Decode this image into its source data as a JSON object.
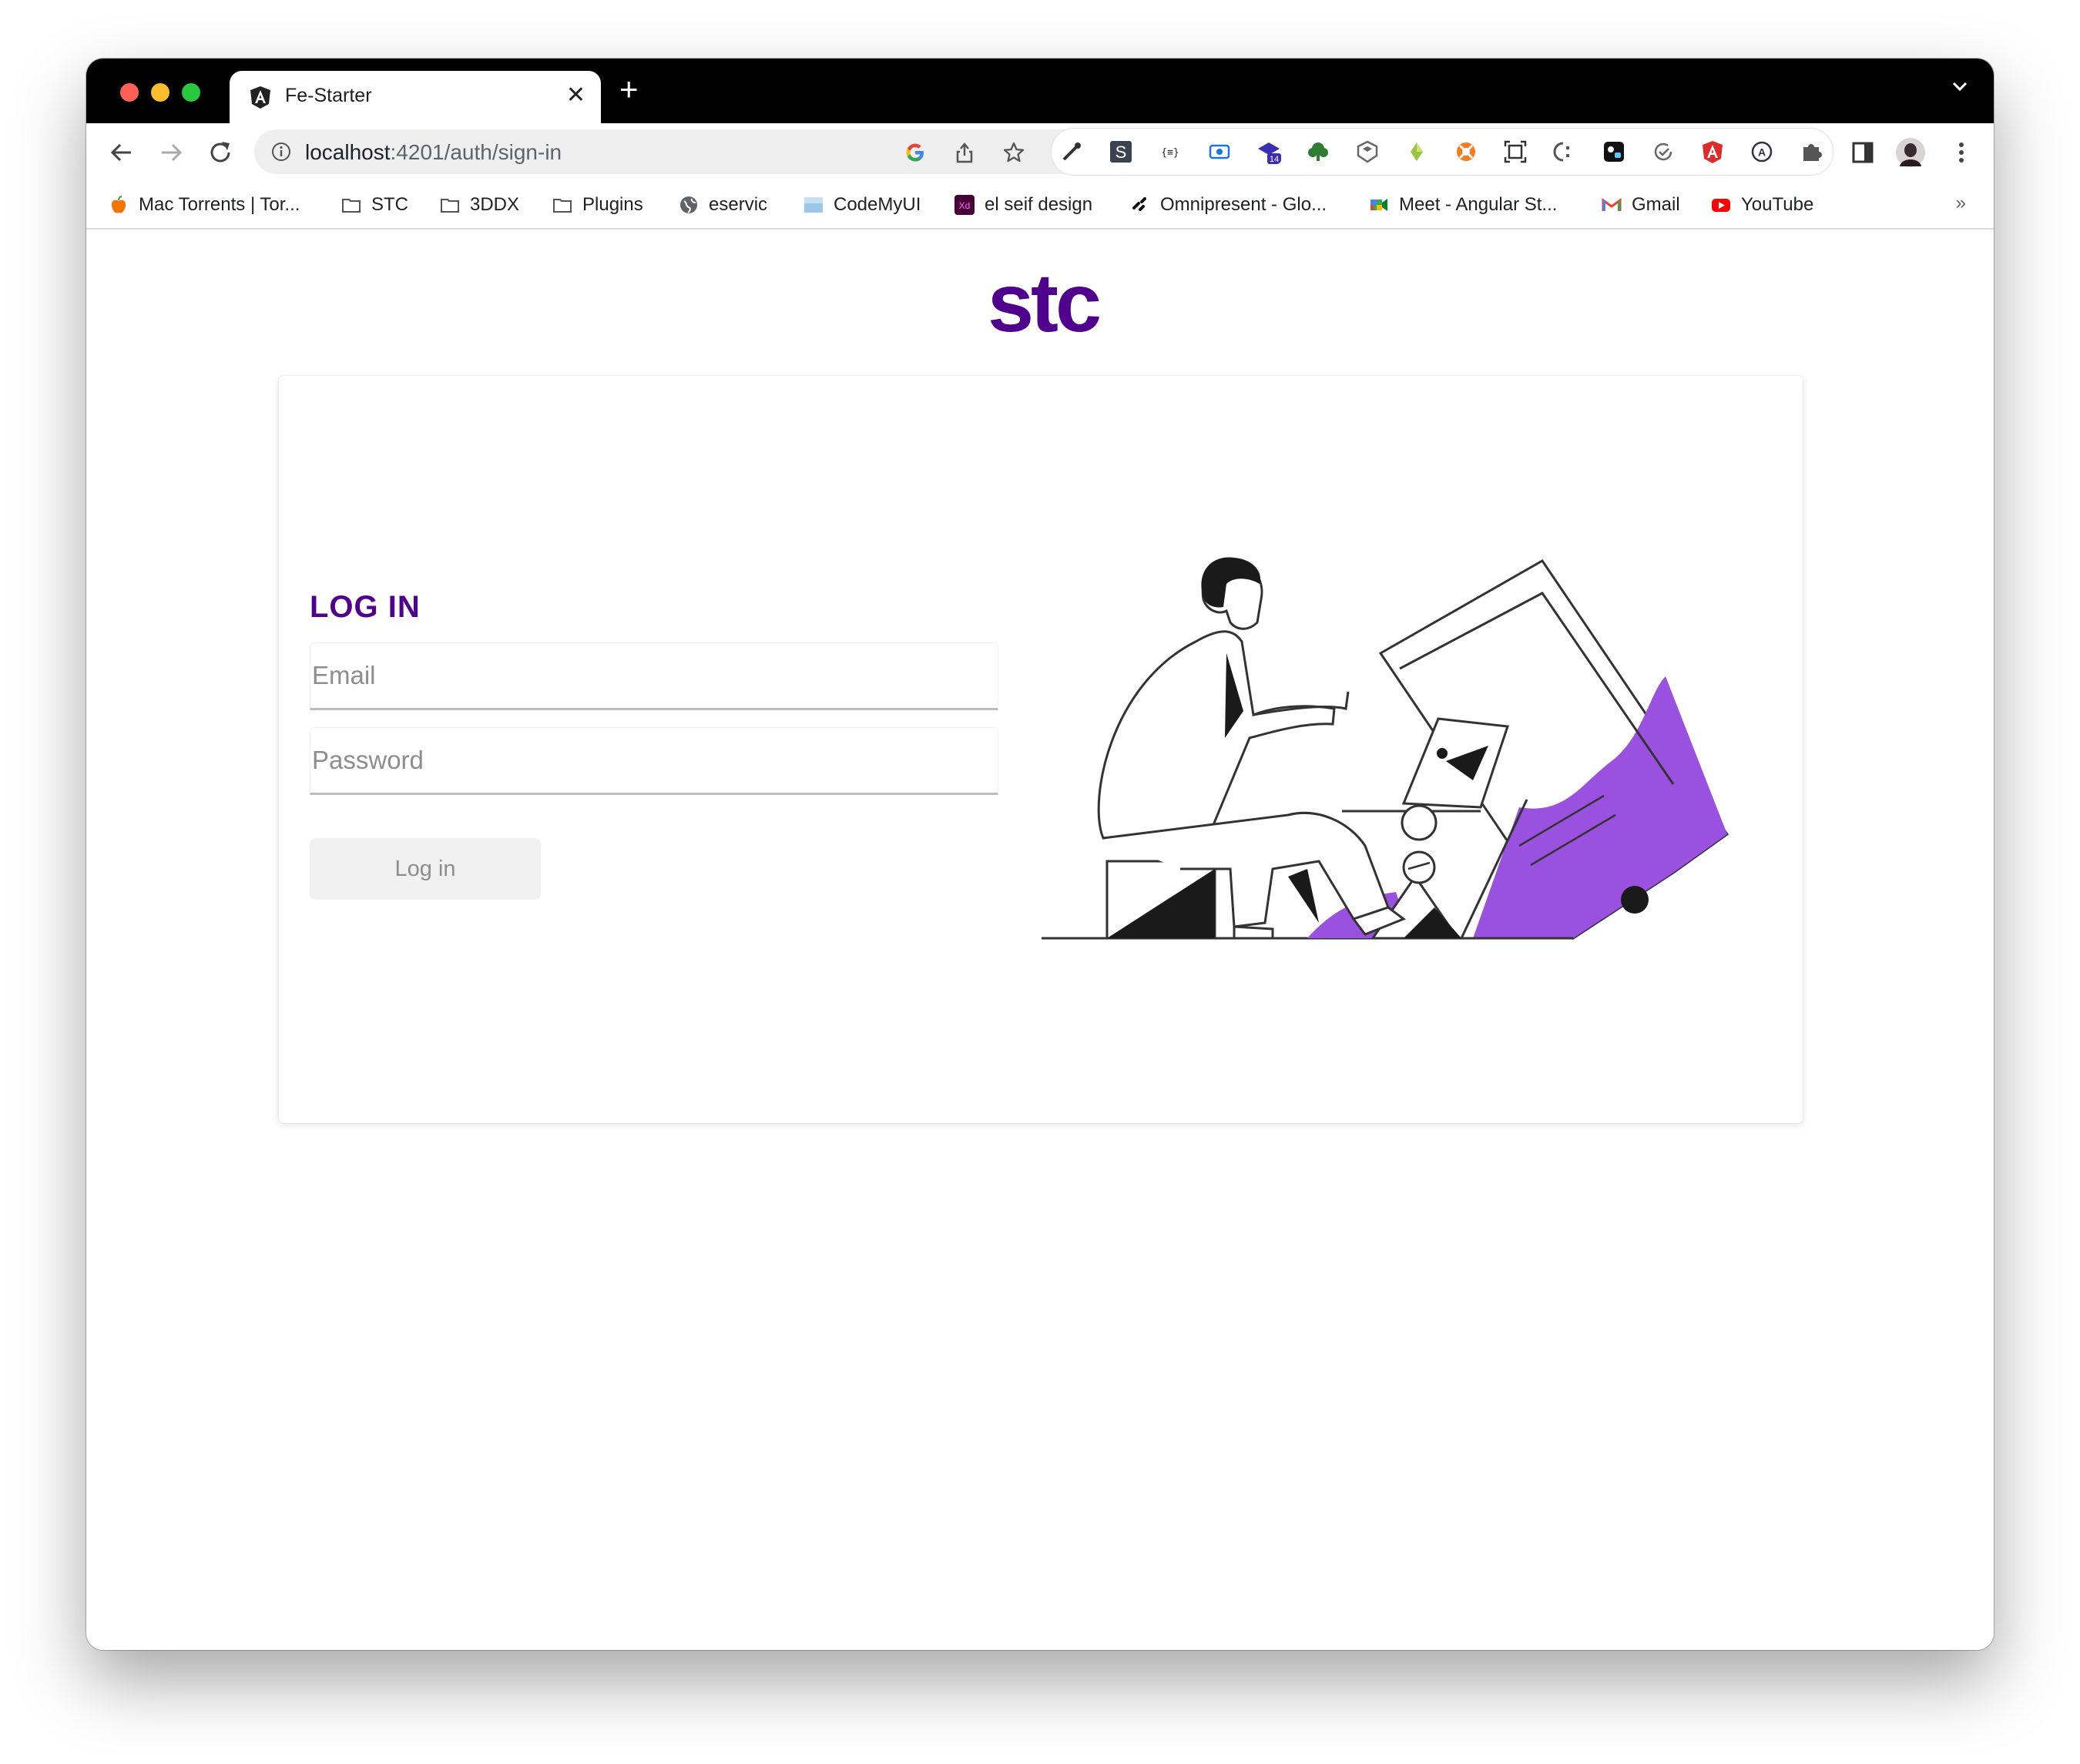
{
  "browser": {
    "tab_title": "Fe-Starter",
    "new_tab_label": "+",
    "url_host": "localhost",
    "url_path": ":4201/auth/sign-in",
    "extension_badge": "14"
  },
  "bookmarks": {
    "items": [
      {
        "label": "Mac Torrents | Tor...",
        "icon": "apple-icon"
      },
      {
        "label": "STC",
        "icon": "folder-icon"
      },
      {
        "label": "3DDX",
        "icon": "folder-icon"
      },
      {
        "label": "Plugins",
        "icon": "folder-icon"
      },
      {
        "label": "eservic",
        "icon": "globe-icon"
      },
      {
        "label": "CodeMyUI",
        "icon": "codemyui-icon"
      },
      {
        "label": "el seif design",
        "icon": "adobe-xd-icon"
      },
      {
        "label": "Omnipresent - Glo...",
        "icon": "omnipresent-icon"
      },
      {
        "label": "Meet - Angular St...",
        "icon": "google-meet-icon"
      },
      {
        "label": "Gmail",
        "icon": "gmail-icon"
      },
      {
        "label": "YouTube",
        "icon": "youtube-icon"
      }
    ],
    "more": "»",
    "xd_badge": "Xd"
  },
  "page": {
    "logo_text": "stc",
    "login_title": "LOG IN",
    "email_placeholder": "Email",
    "password_placeholder": "Password",
    "login_button": "Log in"
  },
  "colors": {
    "brand_purple": "#4f008c",
    "illustration_purple": "#9b51e0"
  }
}
